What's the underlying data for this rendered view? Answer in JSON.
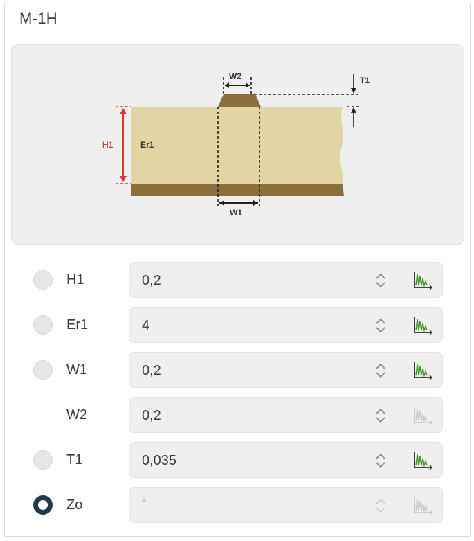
{
  "panel": {
    "title": "M-1H"
  },
  "diagram": {
    "labels": {
      "w2": "W2",
      "t1": "T1",
      "h1": "H1",
      "er1": "Er1",
      "w1": "W1"
    },
    "colors": {
      "substrate": "#e3d4a4",
      "conductor": "#8a6f3a",
      "ground": "#8a6f3a",
      "h1_dimension": "#e0352b",
      "dimension": "#222222"
    }
  },
  "parameters": [
    {
      "radio": true,
      "selected": false,
      "label": "H1",
      "value": "0,2",
      "placeholder": "",
      "icon": "graph-icon",
      "icon_enabled": true
    },
    {
      "radio": true,
      "selected": false,
      "label": "Er1",
      "value": "4",
      "placeholder": "",
      "icon": "graph-icon",
      "icon_enabled": true
    },
    {
      "radio": true,
      "selected": false,
      "label": "W1",
      "value": "0,2",
      "placeholder": "",
      "icon": "graph-icon",
      "icon_enabled": true
    },
    {
      "radio": false,
      "selected": false,
      "label": "W2",
      "value": "0,2",
      "placeholder": "",
      "icon": "graph-icon",
      "icon_enabled": false
    },
    {
      "radio": true,
      "selected": false,
      "label": "T1",
      "value": "0,035",
      "placeholder": "",
      "icon": "graph-icon",
      "icon_enabled": true
    },
    {
      "radio": true,
      "selected": true,
      "label": "Zo",
      "value": "",
      "placeholder": "*",
      "icon": "graph-icon",
      "icon_enabled": false
    }
  ]
}
